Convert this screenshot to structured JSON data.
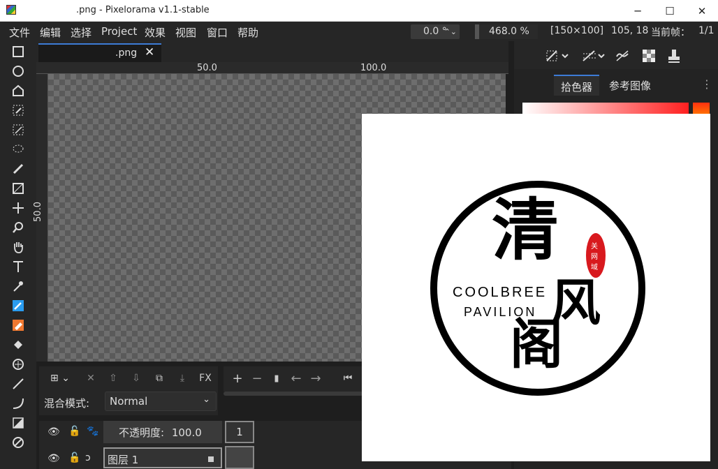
{
  "window": {
    "title": ".png - Pixelorama v1.1-stable",
    "minimize": "─",
    "maximize": "☐",
    "close": "✕"
  },
  "menu": {
    "items": [
      "文件",
      "编辑",
      "选择",
      "Project",
      "效果",
      "视图",
      "窗口",
      "帮助"
    ]
  },
  "status": {
    "rotation": "0.0 °",
    "zoom": "468.0 %",
    "canvas_size": "[150×100]",
    "cursor_pos": "105, 18",
    "current_frame": "当前帧：",
    "frame_count": "1/1"
  },
  "document": {
    "tab_label": ".png",
    "tab_close": "✕"
  },
  "rulers": {
    "h_labels": [
      "50.0",
      "100.0"
    ],
    "v_label": "50.0"
  },
  "right_panel": {
    "tabs": [
      "拾色器",
      "参考图像"
    ],
    "more": "⋮"
  },
  "bottom": {
    "blend_label": "混合模式:",
    "blend_value": "Normal",
    "opacity_label": "不透明度:",
    "opacity_value": "100.0",
    "frame_number": "1",
    "layer_name": "图层 1",
    "fx_label": "FX"
  },
  "logo": {
    "text_line1": "COOLBREE",
    "text_line2": "PAVILION",
    "char_qing": "清",
    "char_feng": "风",
    "char_ge": "阁",
    "seal_text": [
      "关",
      "网",
      "域"
    ]
  },
  "colors": {
    "accent": "#3d7bd6",
    "seal": "#d8191e",
    "pencil": "#2a9cf0",
    "eraser": "#f07830"
  }
}
